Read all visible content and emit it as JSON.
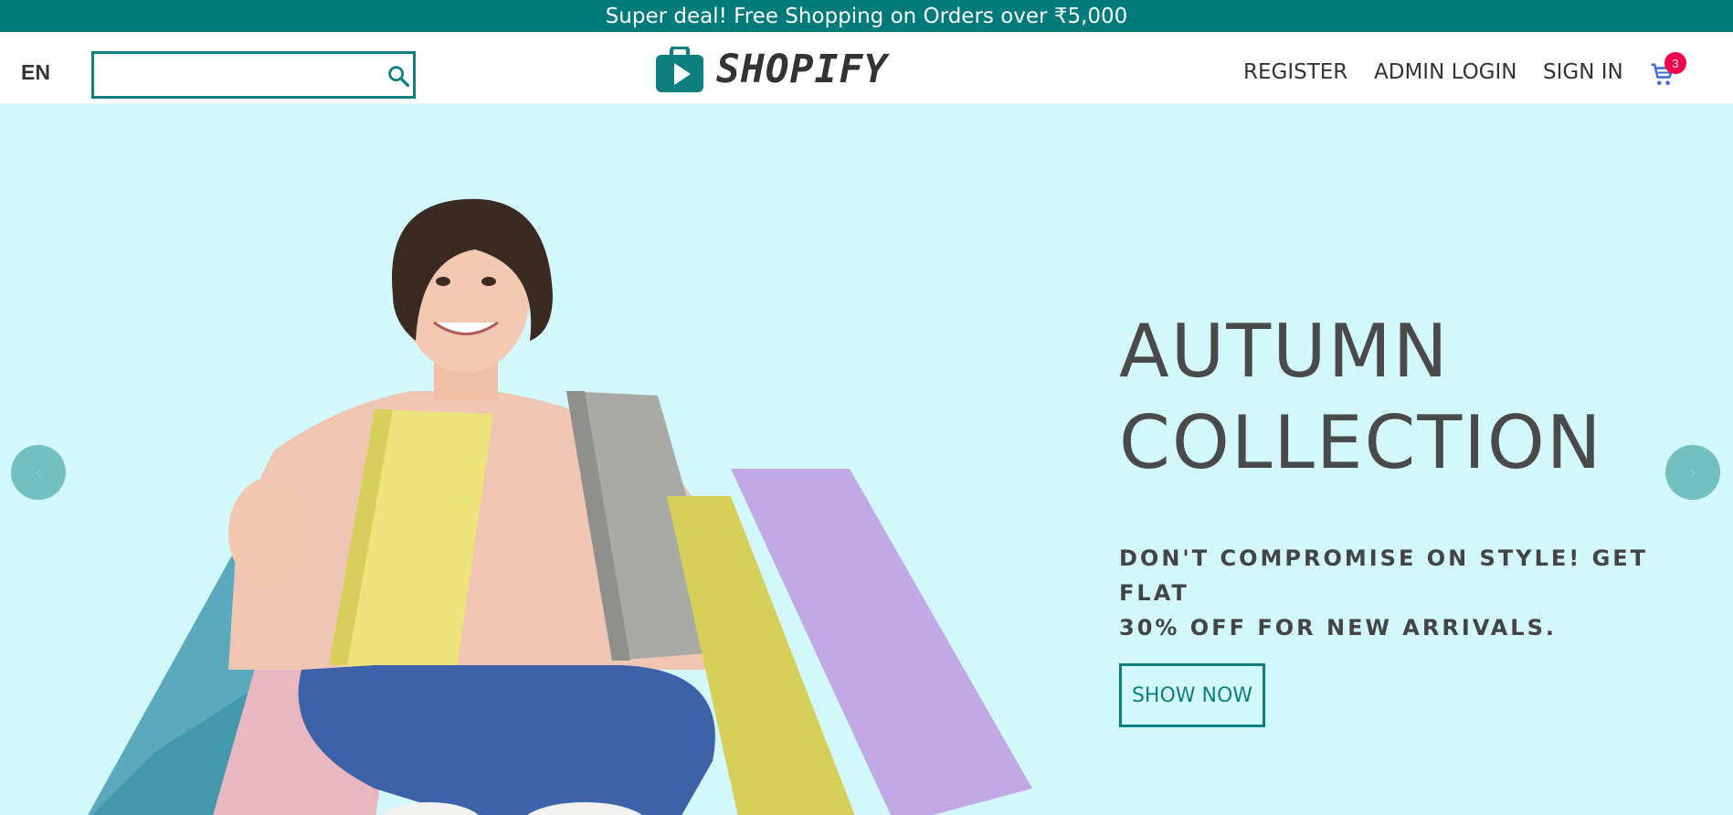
{
  "announcement": {
    "text": "Super deal! Free Shopping on Orders over ₹5,000"
  },
  "header": {
    "language": "EN",
    "search": {
      "value": "",
      "placeholder": ""
    },
    "logo_text": "SHOPIFY",
    "nav": {
      "register": "REGISTER",
      "admin_login": "ADMIN LOGIN",
      "sign_in": "SIGN IN"
    },
    "cart": {
      "count": "3",
      "icon": "cart-icon"
    }
  },
  "hero": {
    "title_line1": "AUTUMN",
    "title_line2": "COLLECTION",
    "subtitle_line1": "DON'T COMPROMISE ON STYLE! GET FLAT",
    "subtitle_line2": "30% OFF FOR NEW ARRIVALS.",
    "button_label": "SHOW NOW",
    "prev_icon": "chevron-left-icon",
    "next_icon": "chevron-right-icon"
  },
  "colors": {
    "brand_teal": "#007a7b",
    "hero_background": "#d2f8fb",
    "badge_pink": "#f2004c",
    "text_dark": "#4a4a4a"
  }
}
